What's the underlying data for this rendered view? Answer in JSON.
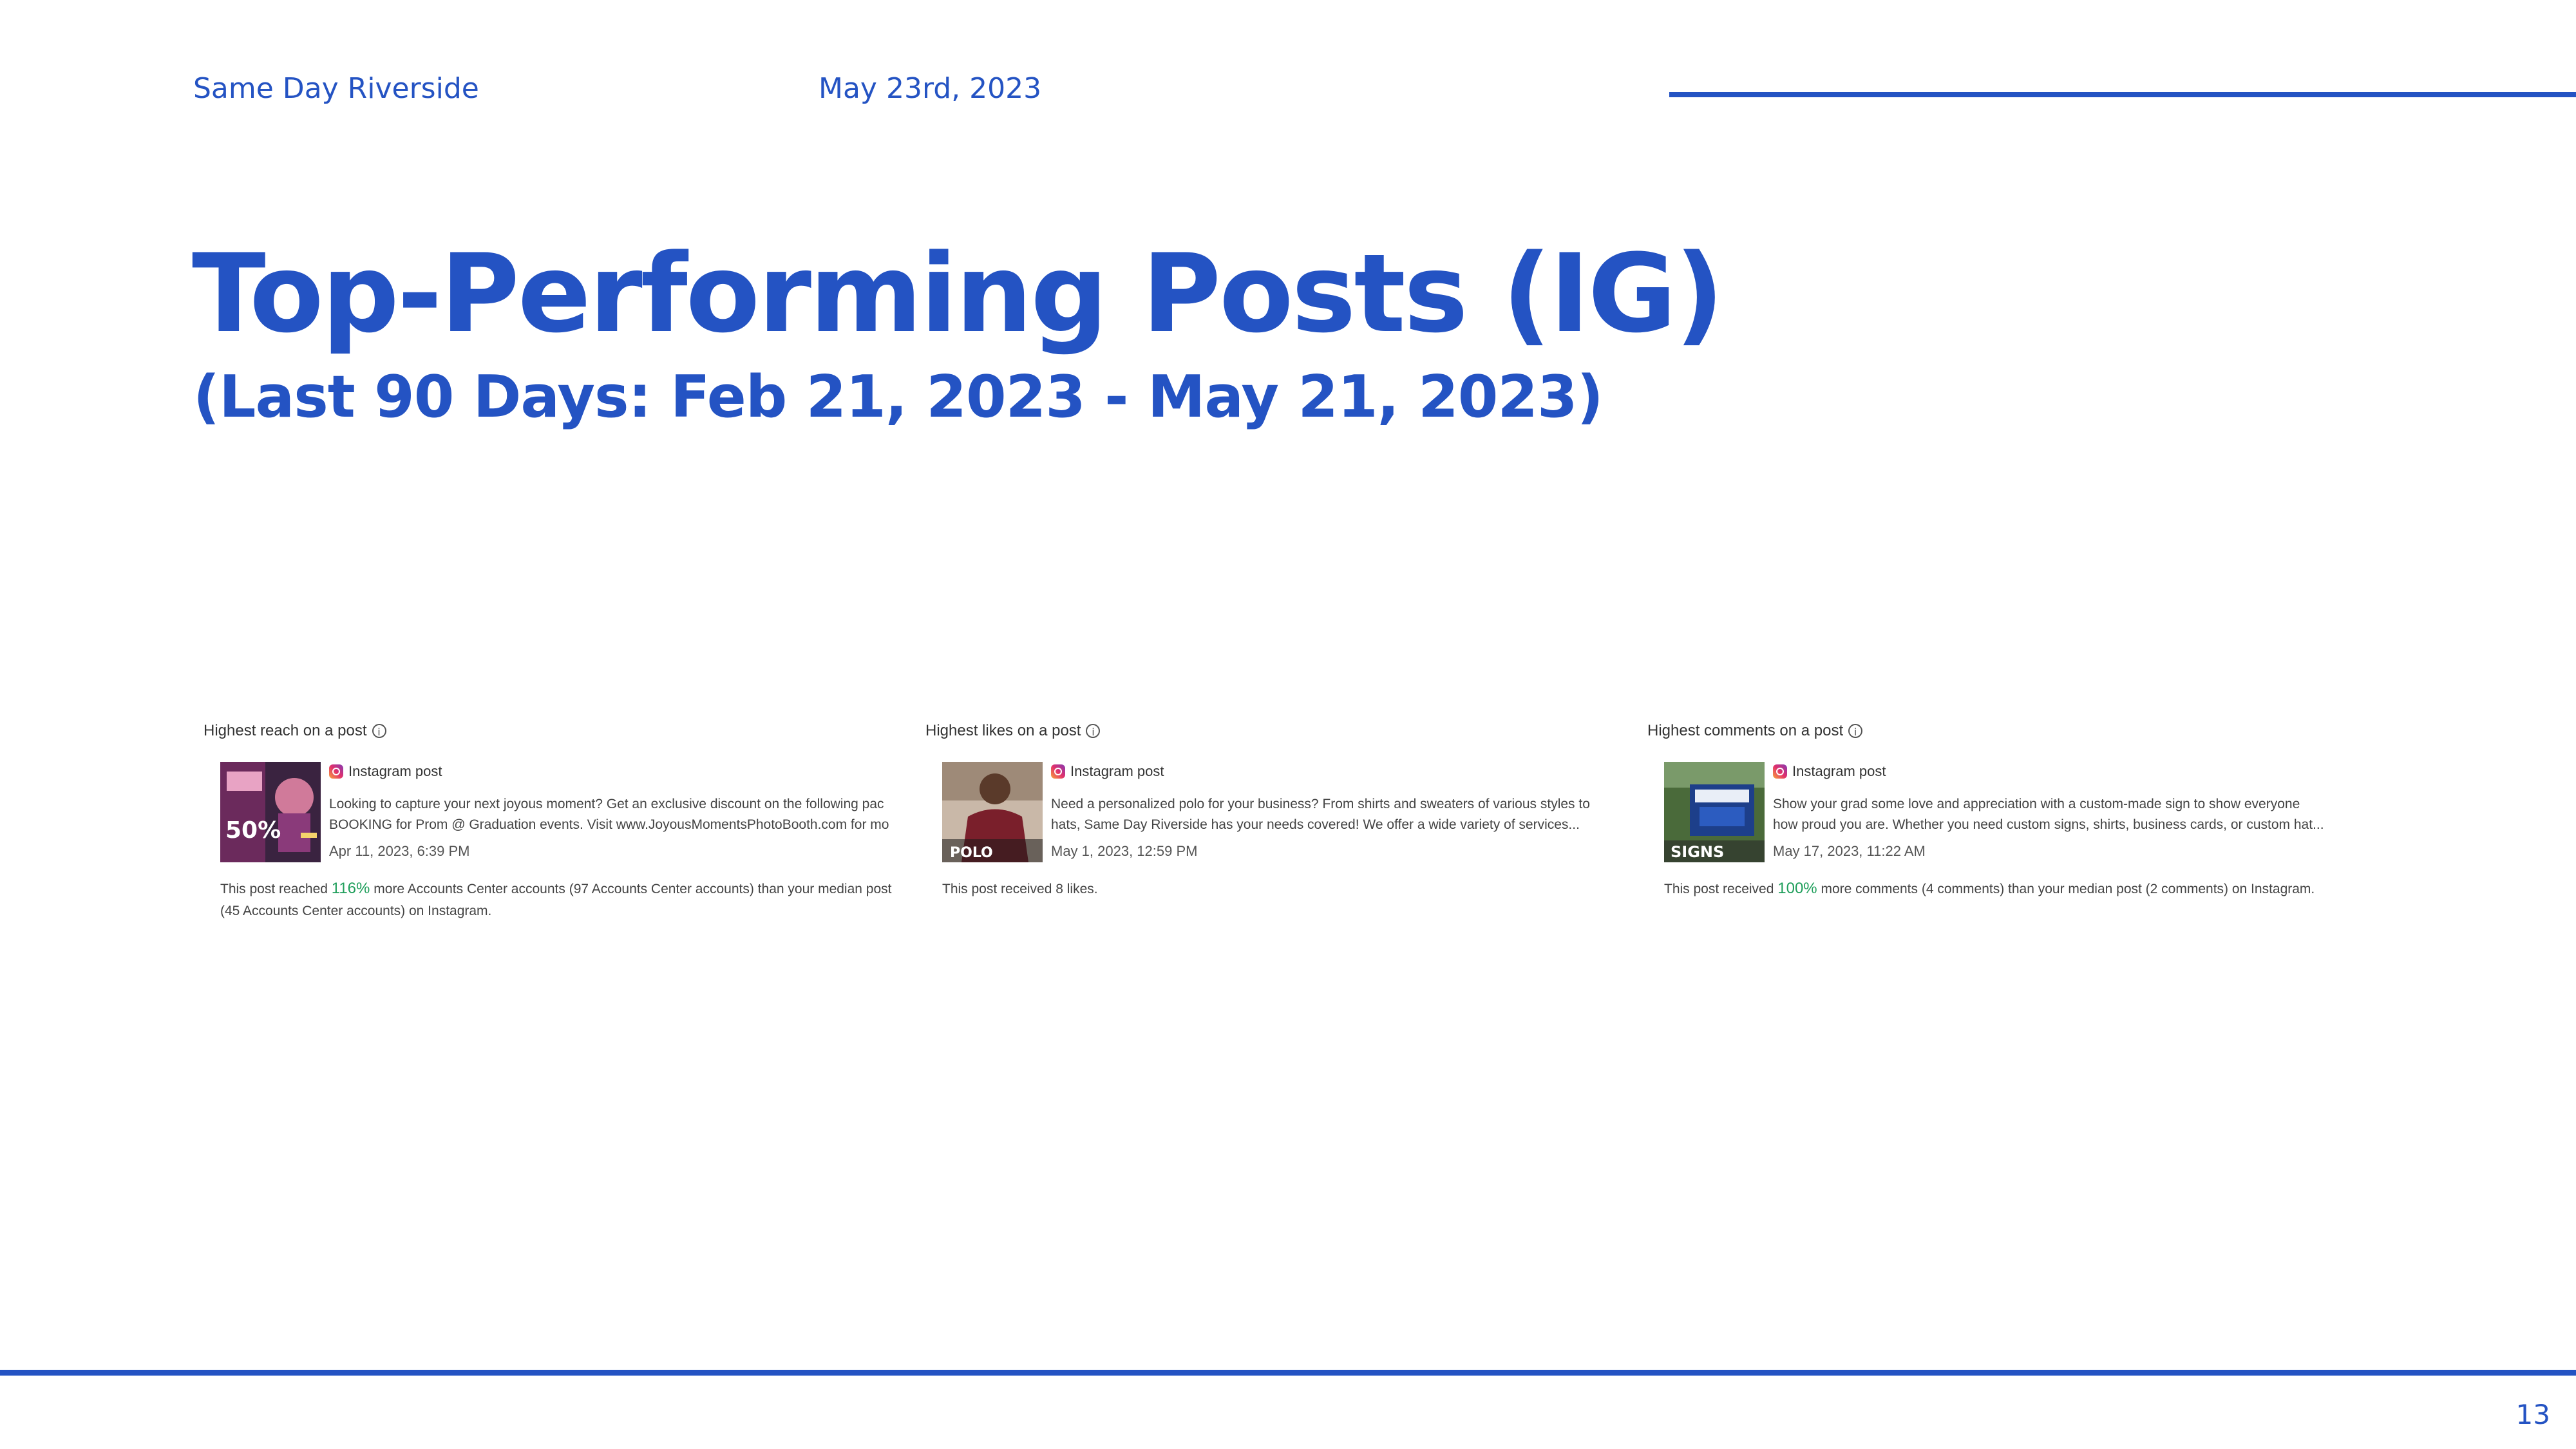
{
  "header": {
    "company": "Same Day Riverside",
    "date": "May 23rd, 2023"
  },
  "title": "Top-Performing Posts (IG)",
  "subtitle": "(Last 90 Days: Feb 21, 2023 - May 21, 2023)",
  "page_number": "13",
  "colors": {
    "brand_blue": "#2453c3",
    "highlight_green": "#1e9e5a"
  },
  "panels": [
    {
      "heading": "Highest reach on a post",
      "post_type": "Instagram post",
      "thumbnail_text": [
        "50%"
      ],
      "text_line1": "Looking to capture your next joyous moment? Get an exclusive discount on the following pac",
      "text_line2": "BOOKING for Prom @ Graduation events. Visit www.JoyousMomentsPhotoBooth.com for mo",
      "time": "Apr 11, 2023, 6:39 PM",
      "note_pre": "This post reached ",
      "note_highlight": "116%",
      "note_post": " more Accounts Center accounts (97 Accounts Center accounts) than your median post (45 Accounts Center accounts) on Instagram."
    },
    {
      "heading": "Highest likes on a post",
      "post_type": "Instagram post",
      "thumbnail_text": [
        "POLO"
      ],
      "text_line1": "Need a personalized polo for your business? From shirts and sweaters of various styles to",
      "text_line2": "hats, Same Day Riverside has your needs covered! We offer a wide variety of services...",
      "time": "May 1, 2023, 12:59 PM",
      "note_pre": "This post received 8 likes.",
      "note_highlight": "",
      "note_post": ""
    },
    {
      "heading": "Highest comments on a post",
      "post_type": "Instagram post",
      "thumbnail_text": [
        "SIGNS"
      ],
      "text_line1": "Show your grad some love and appreciation with a custom-made sign to show everyone",
      "text_line2": "how proud you are. Whether you need custom signs, shirts, business cards, or custom hat...",
      "time": "May 17, 2023, 11:22 AM",
      "note_pre": "This post received ",
      "note_highlight": "100%",
      "note_post": " more comments (4 comments) than your median post (2 comments) on Instagram."
    }
  ]
}
